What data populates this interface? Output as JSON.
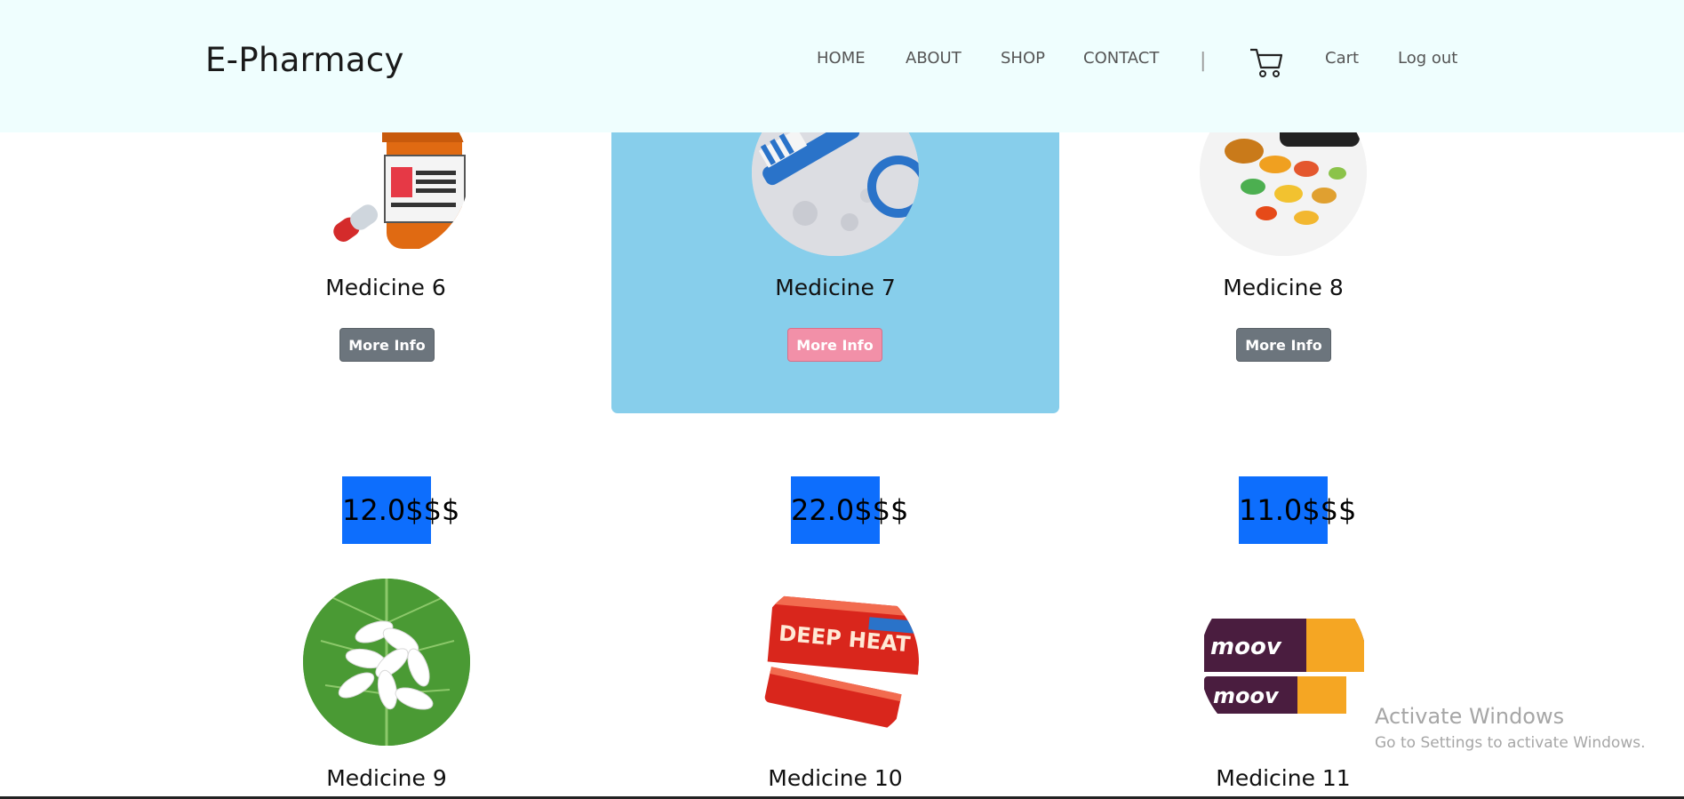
{
  "brand": "E-Pharmacy",
  "nav": {
    "home": "HOME",
    "about": "ABOUT",
    "shop": "SHOP",
    "contact": "CONTACT",
    "separator": "|",
    "cart": "Cart",
    "logout": "Log out",
    "cart_icon": "cart-icon"
  },
  "products_row1": [
    {
      "name": "Medicine 6",
      "button": "More Info"
    },
    {
      "name": "Medicine 7",
      "button": "More Info"
    },
    {
      "name": "Medicine 8",
      "button": "More Info"
    }
  ],
  "prices": [
    "12.0$$$",
    "22.0$$$",
    "11.0$$$"
  ],
  "products_row2": [
    {
      "name": "Medicine 9"
    },
    {
      "name": "Medicine 10"
    },
    {
      "name": "Medicine 11"
    }
  ],
  "watermark": {
    "title": "Activate Windows",
    "subtitle": "Go to Settings to activate Windows."
  },
  "colors": {
    "navbar_bg": "#effefe",
    "highlight_card": "#87ceeb",
    "price_bg": "#0d6efd",
    "button_gray": "#6c757d",
    "button_pink": "#f290a8"
  }
}
